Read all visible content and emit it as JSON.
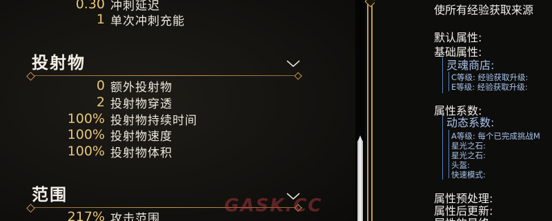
{
  "top_stats": [
    {
      "value": "0.30",
      "label": "冲刺延迟"
    },
    {
      "value": "1",
      "label": "单次冲刺充能"
    }
  ],
  "sections": [
    {
      "title": "投射物",
      "stats": [
        {
          "value": "0",
          "label": "额外投射物"
        },
        {
          "value": "2",
          "label": "投射物穿透"
        },
        {
          "value": "100%",
          "label": "投射物持续时间"
        },
        {
          "value": "100%",
          "label": "投射物速度"
        },
        {
          "value": "100%",
          "label": "投射物体积"
        }
      ]
    },
    {
      "title": "范围",
      "stats": [
        {
          "value": "217%",
          "label": "攻击范围"
        }
      ]
    }
  ],
  "right_panel": {
    "header": "使所有经验获取来源",
    "default_attr": "默认属性:",
    "base_attr": "基础属性:",
    "soul_shop": "灵魂商店:",
    "c_level": "C等级: 经验获取升级:",
    "e_level": "E等级: 经验获取升级:",
    "attr_coeff": "属性系数:",
    "dynamic_coeff": "动态系数:",
    "a_level": "A等级: 每个已完成挑战M",
    "star_stone_1": "星光之石:",
    "star_stone_2": "星光之石:",
    "helmet": "头盔:",
    "quick_mode": "快速模式:",
    "pre_process": "属性预处理:",
    "post_update": "属性后更新:",
    "final_attr": "属性的最终..."
  },
  "watermark": "GASK.CC",
  "colors": {
    "value_gold": "#e8c77a",
    "divider_gold": "#c99a55",
    "frame_gold": "#c9a050",
    "blue_text": "#a9c4ec"
  }
}
